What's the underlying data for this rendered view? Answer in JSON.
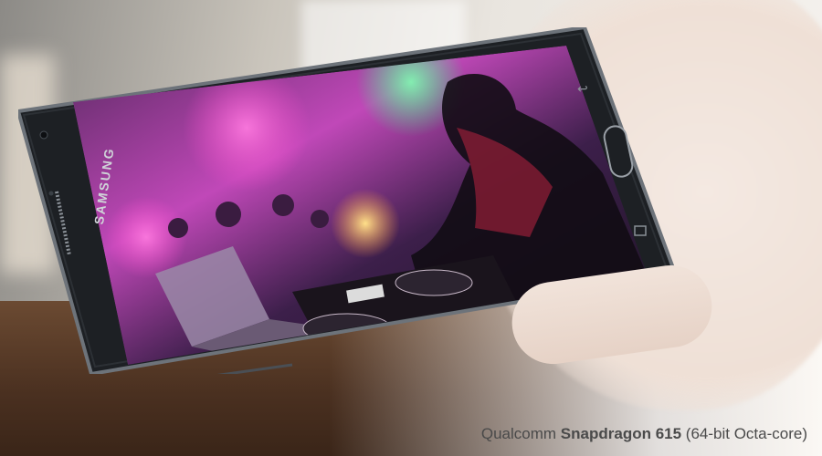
{
  "phone": {
    "brand": "SAMSUNG"
  },
  "caption": {
    "prefix": "Qualcomm",
    "highlight": "Snapdragon 615",
    "suffix": "(64-bit Octa-core)"
  }
}
